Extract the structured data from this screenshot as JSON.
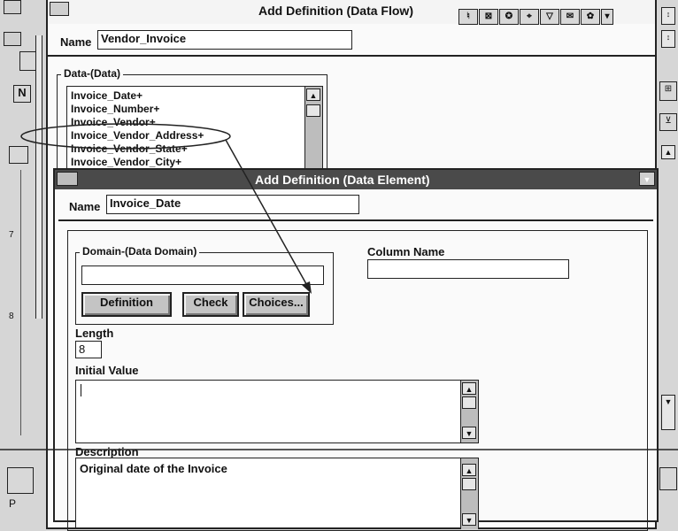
{
  "data_flow_window": {
    "title": "Add  Definition (Data Flow)",
    "name_label": "Name",
    "name_value": "Vendor_Invoice",
    "data_group_label": "Data-(Data)",
    "data_items": [
      "Invoice_Date+",
      "Invoice_Number+",
      "Invoice_Vendor+",
      "Invoice_Vendor_Address+",
      "Invoice_Vendor_State+",
      "Invoice_Vendor_City+"
    ],
    "toolbar_icons": [
      "tool-1-icon",
      "tool-2-icon",
      "tool-3-icon",
      "tool-4-icon",
      "tool-5-icon",
      "tool-6-icon",
      "tool-7-icon",
      "dropdown-arrow-icon"
    ]
  },
  "data_element_window": {
    "title": "Add  Definition (Data Element)",
    "name_label": "Name",
    "name_value": "Invoice_Date",
    "domain_group_label": "Domain-(Data Domain)",
    "domain_value": "",
    "definition_button": "Definition",
    "check_button": "Check",
    "choices_button": "Choices...",
    "column_name_label": "Column Name",
    "column_name_value": "",
    "length_label": "Length",
    "length_value": "8",
    "initial_value_label": "Initial Value",
    "initial_value_value": "",
    "description_label": "Description",
    "description_value": "Original date of the Invoice"
  },
  "background": {
    "left_glyph_1": "N",
    "ruler_ticks": [
      "7",
      "8"
    ],
    "bottom_glyph": "P"
  },
  "colors": {
    "active_titlebar": "#4a4a4a",
    "inactive_titlebar": "#9a9a9a",
    "window_bg": "#fafafa",
    "annotation_line": "#222222"
  }
}
